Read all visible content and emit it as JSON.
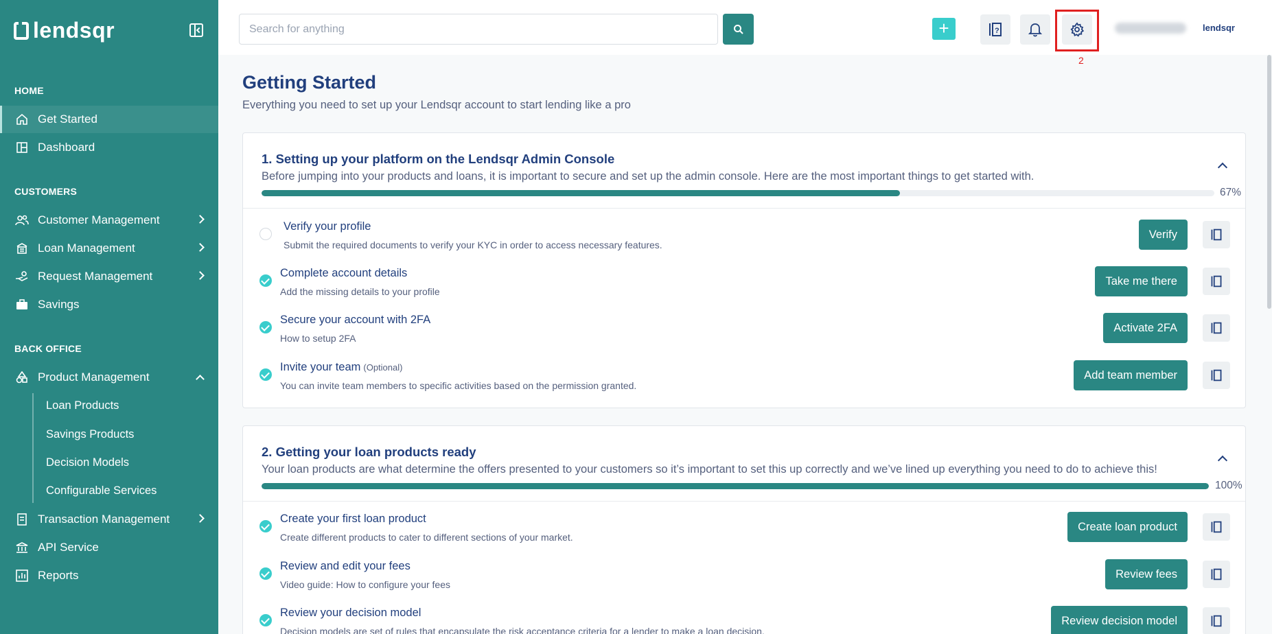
{
  "brand": {
    "name": "lendsqr"
  },
  "colors": {
    "sidebar": "#2a8783",
    "accent": "#39cdcc",
    "heading": "#213f7d",
    "highlight": "#e02020"
  },
  "sidebar": {
    "sections": {
      "home": "HOME",
      "customers": "CUSTOMERS",
      "back_office": "BACK OFFICE"
    },
    "items": {
      "get_started": "Get Started",
      "dashboard": "Dashboard",
      "customer_management": "Customer Management",
      "loan_management": "Loan Management",
      "request_management": "Request Management",
      "savings": "Savings",
      "product_management": "Product Management",
      "loan_products": "Loan Products",
      "savings_products": "Savings Products",
      "decision_models": "Decision Models",
      "configurable_services": "Configurable Services",
      "transaction_management": "Transaction Management",
      "api_service": "API Service",
      "reports": "Reports"
    }
  },
  "topbar": {
    "search_placeholder": "Search for anything",
    "plus_label": "+",
    "annotation_number": "2",
    "mini_logo": "lendsqr"
  },
  "main": {
    "title": "Getting Started",
    "subtitle": "Everything you need to set up your Lendsqr account to start lending like a pro",
    "cards": [
      {
        "title": "1. Setting up your platform on the Lendsqr Admin Console",
        "description": "Before jumping into your products and loans, it is important to secure and set up the admin console. Here are the most important things to get started with.",
        "progress_percent": 67,
        "progress_label": "67%",
        "rows": [
          {
            "title": "Verify your profile",
            "description": "Submit the required documents to verify your KYC in order to access necessary features.",
            "action": "Verify",
            "done": false
          },
          {
            "title": "Complete account details",
            "description": "Add the missing details to your profile",
            "action": "Take me there",
            "done": true
          },
          {
            "title": "Secure your account with 2FA",
            "description": "How to setup 2FA",
            "action": "Activate 2FA",
            "done": true
          },
          {
            "title": "Invite your team",
            "optional": "(Optional)",
            "description": "You can invite team members to specific activities based on the permission granted.",
            "action": "Add team member",
            "done": true
          }
        ]
      },
      {
        "title": "2. Getting your loan products ready",
        "description": "Your loan products are what determine the offers presented to your customers so it’s important to set this up correctly and we’ve lined up everything you need to do to achieve this!",
        "progress_percent": 100,
        "progress_label": "100%",
        "rows": [
          {
            "title": "Create your first loan product",
            "description": "Create different products to cater to different sections of your market.",
            "action": "Create loan product",
            "done": true
          },
          {
            "title": "Review and edit your fees",
            "description": "Video guide: How to configure your fees",
            "action": "Review fees",
            "done": true
          },
          {
            "title": "Review your decision model",
            "description": "Decision models are set of rules that encapsulate the risk acceptance criteria for a lender to make a loan decision.",
            "action": "Review decision model",
            "done": true
          }
        ]
      }
    ]
  }
}
